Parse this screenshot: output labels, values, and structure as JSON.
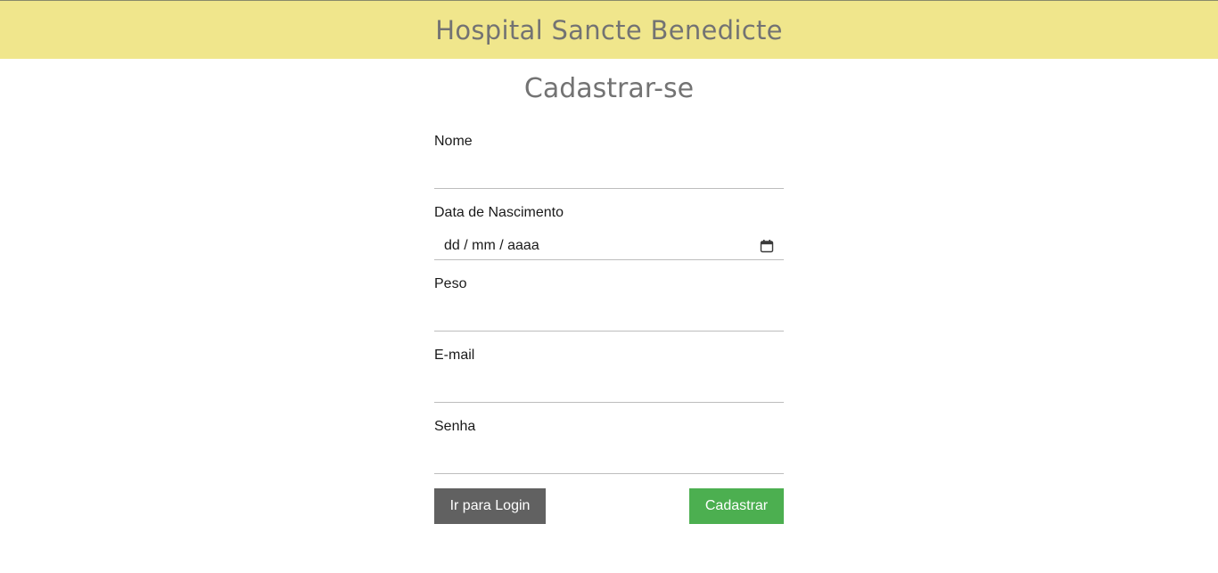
{
  "header": {
    "title": "Hospital Sancte Benedicte",
    "background_color": "#f0e68c"
  },
  "page_title": "Cadastrar-se",
  "form": {
    "fields": [
      {
        "label": "Nome",
        "value": "",
        "placeholder": ""
      },
      {
        "label": "Data de Nascimento",
        "value": "",
        "placeholder": "dd / mm / aaaa",
        "icon": "calendar-icon"
      },
      {
        "label": "Peso",
        "value": "",
        "placeholder": ""
      },
      {
        "label": "E-mail",
        "value": "",
        "placeholder": ""
      },
      {
        "label": "Senha",
        "value": "",
        "placeholder": ""
      }
    ]
  },
  "buttons": {
    "login_label": "Ir para Login",
    "login_color": "#616161",
    "register_label": "Cadastrar",
    "register_color": "#4caf50"
  }
}
